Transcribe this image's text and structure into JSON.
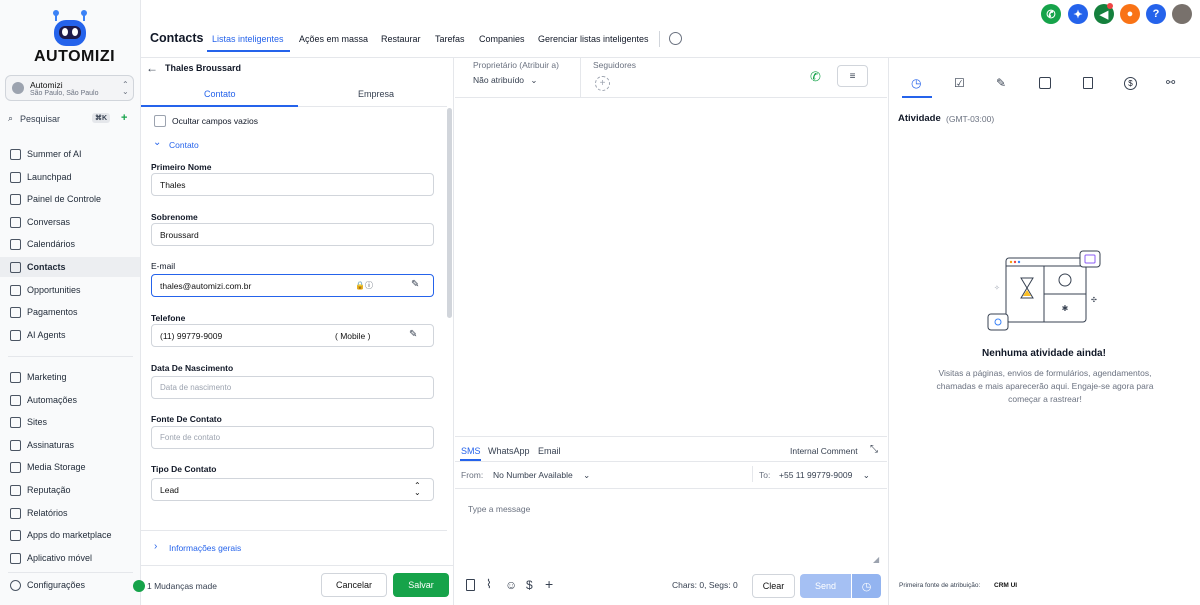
{
  "brand": {
    "name": "AUTOMIZI"
  },
  "account": {
    "name": "Automizi",
    "location": "São Paulo, São Paulo"
  },
  "search": {
    "label": "Pesquisar",
    "shortcut": "⌘K"
  },
  "nav": {
    "items": [
      {
        "label": "Summer of AI"
      },
      {
        "label": "Launchpad"
      },
      {
        "label": "Painel de Controle"
      },
      {
        "label": "Conversas"
      },
      {
        "label": "Calendários"
      },
      {
        "label": "Contacts"
      },
      {
        "label": "Opportunities"
      },
      {
        "label": "Pagamentos"
      },
      {
        "label": "AI Agents"
      }
    ],
    "items2": [
      {
        "label": "Marketing"
      },
      {
        "label": "Automações"
      },
      {
        "label": "Sites"
      },
      {
        "label": "Assinaturas"
      },
      {
        "label": "Media Storage"
      },
      {
        "label": "Reputação"
      },
      {
        "label": "Relatórios"
      },
      {
        "label": "Apps do marketplace"
      },
      {
        "label": "Aplicativo móvel"
      }
    ],
    "settings": "Configurações"
  },
  "header": {
    "title": "Contacts",
    "tabs": [
      "Listas inteligentes",
      "Ações em massa",
      "Restaurar",
      "Tarefas",
      "Companies",
      "Gerenciar listas inteligentes"
    ],
    "active_tab": "Listas inteligentes"
  },
  "contact": {
    "name": "Thales Broussard",
    "subtabs": [
      "Contato",
      "Empresa"
    ],
    "hide_empty": "Ocultar campos vazios",
    "section": "Contato",
    "fields": {
      "first_name": {
        "label": "Primeiro Nome",
        "value": "Thales"
      },
      "last_name": {
        "label": "Sobrenome",
        "value": "Broussard"
      },
      "email": {
        "label": "E-mail",
        "value": "thales@automizi.com.br"
      },
      "phone": {
        "label": "Telefone",
        "value": "(11) 99779-9009",
        "type": "( Mobile )"
      },
      "birth": {
        "label": "Data De Nascimento",
        "placeholder": "Data de nascimento"
      },
      "source": {
        "label": "Fonte De Contato",
        "placeholder": "Fonte de contato"
      },
      "type": {
        "label": "Tipo De Contato",
        "value": "Lead"
      }
    },
    "general_info": "Informações gerais",
    "changes": "1 Mudanças made",
    "cancel": "Cancelar",
    "save": "Salvar"
  },
  "conversation": {
    "owner_label": "Proprietário (Atribuir a)",
    "owner_value": "Não atribuído",
    "followers_label": "Seguidores",
    "channels": [
      "SMS",
      "WhatsApp",
      "Email"
    ],
    "internal_comment": "Internal Comment",
    "from_label": "From:",
    "from_value": "No Number Available",
    "to_label": "To:",
    "to_value": "+55 11 99779-9009",
    "placeholder": "Type a message",
    "counter": "Chars: 0, Segs: 0",
    "clear": "Clear",
    "send": "Send"
  },
  "activity": {
    "title": "Atividade",
    "timezone": "(GMT-03:00)",
    "empty_title": "Nenhuma atividade ainda!",
    "empty_desc": "Visitas a páginas, envios de formulários, agendamentos, chamadas e mais aparecerão aqui. Engaje-se agora para começar a rastrear!",
    "attribution_label": "Primeira fonte de atribuição:",
    "attribution_value": "CRM UI"
  },
  "colors": {
    "accent": "#2563eb",
    "save": "#16a34a",
    "send": "#a5c0f3"
  }
}
